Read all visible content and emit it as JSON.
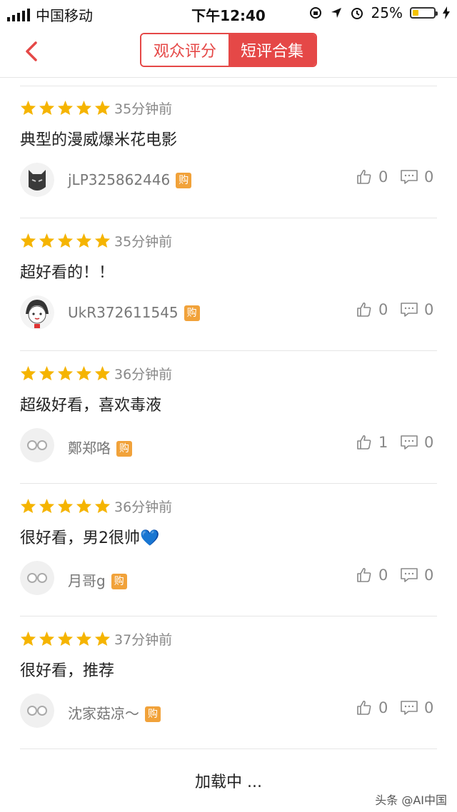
{
  "status_bar": {
    "carrier": "中国移动",
    "time": "下午12:40",
    "battery_percent": "25%"
  },
  "nav": {
    "tab_audience": "观众评分",
    "tab_short": "短评合集",
    "active_tab": "短评合集"
  },
  "colors": {
    "accent": "#e54847",
    "star": "#f5b400",
    "badge": "#f1a23a"
  },
  "reviews": [
    {
      "stars": 5,
      "time": "35分钟前",
      "content": "典型的漫威爆米花电影",
      "user": "jLP325862446",
      "badge": "购",
      "avatar": "black-panther-avatar",
      "likes": "0",
      "comments": "0"
    },
    {
      "stars": 5,
      "time": "35分钟前",
      "content": "超好看的！！",
      "user": "UkR372611545",
      "badge": "购",
      "avatar": "cartoon-girl-avatar",
      "likes": "0",
      "comments": "0"
    },
    {
      "stars": 5,
      "time": "36分钟前",
      "content": "超级好看，喜欢毒液",
      "user": "鄭郑咯",
      "badge": "购",
      "avatar": "glasses-avatar",
      "likes": "1",
      "comments": "0"
    },
    {
      "stars": 5,
      "time": "36分钟前",
      "content": "很好看，男2很帅💙",
      "user": "月哥g",
      "badge": "购",
      "avatar": "glasses-avatar",
      "likes": "0",
      "comments": "0"
    },
    {
      "stars": 5,
      "time": "37分钟前",
      "content": "很好看，推荐",
      "user": "沈家菇凉～",
      "badge": "购",
      "avatar": "glasses-avatar",
      "likes": "0",
      "comments": "0"
    }
  ],
  "footer": {
    "loading": "加载中 ...",
    "watermark": "头条 @AI中国"
  }
}
